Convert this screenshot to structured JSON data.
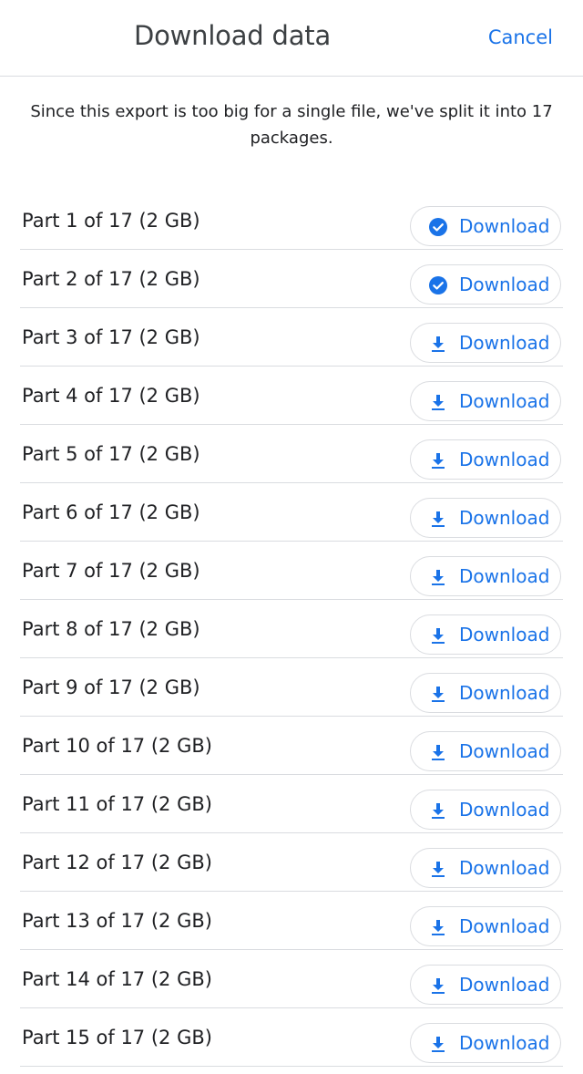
{
  "header": {
    "title": "Download data",
    "cancel_label": "Cancel"
  },
  "notice": "Since this export is too big for a single file, we've split it into 17 packages.",
  "colors": {
    "accent": "#1a73e8",
    "divider": "#dadce0",
    "text": "#202124"
  },
  "parts": [
    {
      "label": "Part 1 of 17 (2 GB)",
      "button": "Download",
      "icon": "check-circle-icon",
      "downloaded": true
    },
    {
      "label": "Part 2 of 17 (2 GB)",
      "button": "Download",
      "icon": "check-circle-icon",
      "downloaded": true
    },
    {
      "label": "Part 3 of 17 (2 GB)",
      "button": "Download",
      "icon": "download-icon",
      "downloaded": false
    },
    {
      "label": "Part 4 of 17 (2 GB)",
      "button": "Download",
      "icon": "download-icon",
      "downloaded": false
    },
    {
      "label": "Part 5 of 17 (2 GB)",
      "button": "Download",
      "icon": "download-icon",
      "downloaded": false
    },
    {
      "label": "Part 6 of 17 (2 GB)",
      "button": "Download",
      "icon": "download-icon",
      "downloaded": false
    },
    {
      "label": "Part 7 of 17 (2 GB)",
      "button": "Download",
      "icon": "download-icon",
      "downloaded": false
    },
    {
      "label": "Part 8 of 17 (2 GB)",
      "button": "Download",
      "icon": "download-icon",
      "downloaded": false
    },
    {
      "label": "Part 9 of 17 (2 GB)",
      "button": "Download",
      "icon": "download-icon",
      "downloaded": false
    },
    {
      "label": "Part 10 of 17 (2 GB)",
      "button": "Download",
      "icon": "download-icon",
      "downloaded": false
    },
    {
      "label": "Part 11 of 17 (2 GB)",
      "button": "Download",
      "icon": "download-icon",
      "downloaded": false
    },
    {
      "label": "Part 12 of 17 (2 GB)",
      "button": "Download",
      "icon": "download-icon",
      "downloaded": false
    },
    {
      "label": "Part 13 of 17 (2 GB)",
      "button": "Download",
      "icon": "download-icon",
      "downloaded": false
    },
    {
      "label": "Part 14 of 17 (2 GB)",
      "button": "Download",
      "icon": "download-icon",
      "downloaded": false
    },
    {
      "label": "Part 15 of 17 (2 GB)",
      "button": "Download",
      "icon": "download-icon",
      "downloaded": false
    }
  ]
}
